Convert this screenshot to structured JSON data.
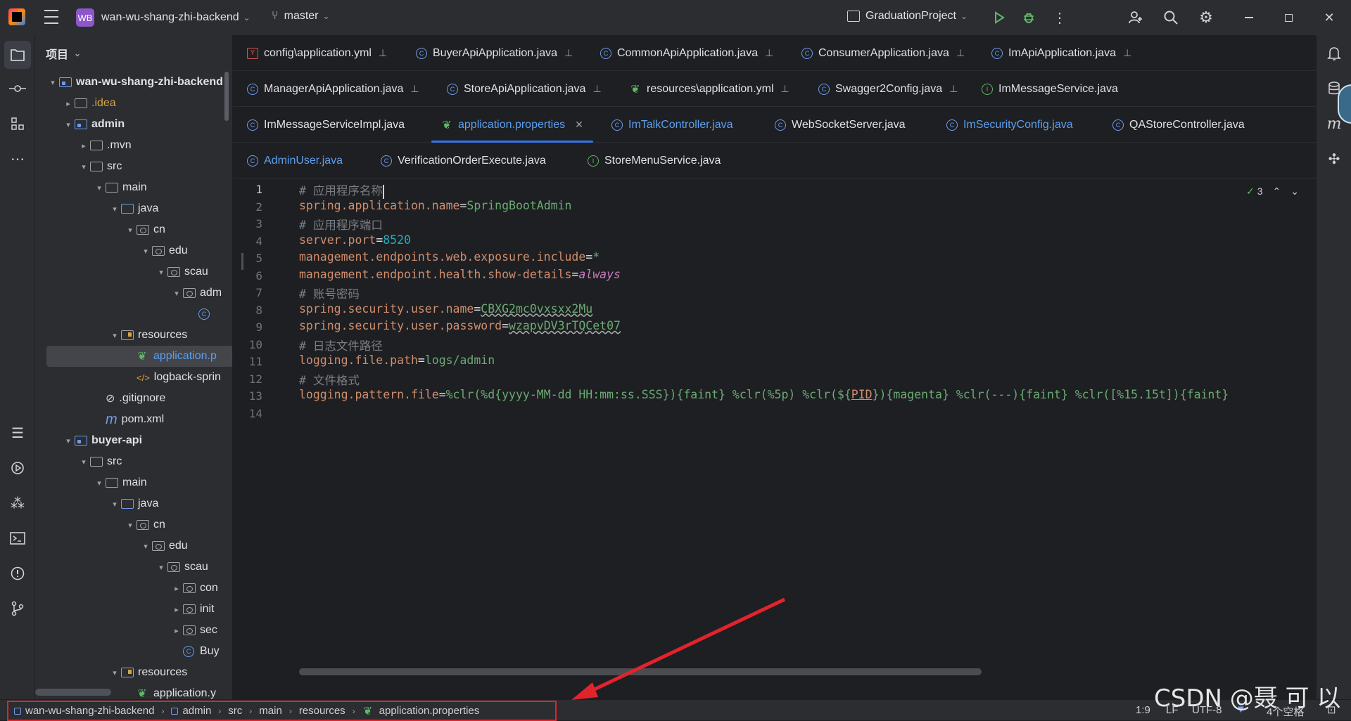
{
  "titlebar": {
    "project_badge": "WB",
    "project_name": "wan-wu-shang-zhi-backend",
    "branch": "master",
    "run_config": "GraduationProject"
  },
  "project_panel": {
    "title": "项目",
    "tree": [
      {
        "label": "wan-wu-shang-zhi-backend",
        "bold": true
      },
      {
        "label": ".idea"
      },
      {
        "label": "admin",
        "bold": true
      },
      {
        "label": ".mvn"
      },
      {
        "label": "src"
      },
      {
        "label": "main"
      },
      {
        "label": "java"
      },
      {
        "label": "cn"
      },
      {
        "label": "edu"
      },
      {
        "label": "scau"
      },
      {
        "label": "adm"
      },
      {
        "label": ""
      },
      {
        "label": "resources"
      },
      {
        "label": "application.p"
      },
      {
        "label": "logback-sprin"
      },
      {
        "label": ".gitignore"
      },
      {
        "label": "pom.xml"
      },
      {
        "label": "buyer-api",
        "bold": true
      },
      {
        "label": "src"
      },
      {
        "label": "main"
      },
      {
        "label": "java"
      },
      {
        "label": "cn"
      },
      {
        "label": "edu"
      },
      {
        "label": "scau"
      },
      {
        "label": "con"
      },
      {
        "label": "init"
      },
      {
        "label": "sec"
      },
      {
        "label": "Buy"
      },
      {
        "label": "resources"
      },
      {
        "label": "application.y"
      }
    ]
  },
  "tabs": {
    "row1": [
      "config\\application.yml",
      "BuyerApiApplication.java",
      "CommonApiApplication.java",
      "ConsumerApplication.java",
      "ImApiApplication.java"
    ],
    "row2": [
      "ManagerApiApplication.java",
      "StoreApiApplication.java",
      "resources\\application.yml",
      "Swagger2Config.java",
      "ImMessageService.java"
    ],
    "row3": [
      "ImMessageServiceImpl.java",
      "application.properties",
      "ImTalkController.java",
      "WebSocketServer.java",
      "ImSecurityConfig.java",
      "QAStoreController.java"
    ],
    "row4": [
      "AdminUser.java",
      "VerificationOrderExecute.java",
      "StoreMenuService.java"
    ]
  },
  "editor": {
    "inspection_count": "3",
    "lines": [
      {
        "n": "1",
        "comment": "# 应用程序名称"
      },
      {
        "n": "2",
        "key": "spring.application.name",
        "value": "SpringBootAdmin"
      },
      {
        "n": "3",
        "comment": "# 应用程序端口"
      },
      {
        "n": "4",
        "key": "server.port",
        "value": "8520"
      },
      {
        "n": "5",
        "key": "management.endpoints.web.exposure.include",
        "value": "*"
      },
      {
        "n": "6",
        "key": "management.endpoint.health.show-details",
        "value": "always"
      },
      {
        "n": "7",
        "comment": "# 账号密码"
      },
      {
        "n": "8",
        "key": "spring.security.user.name",
        "value": "CBXG2mc0vxsxx2Mu"
      },
      {
        "n": "9",
        "key": "spring.security.user.password",
        "value": "wzapvDV3rTQCet07"
      },
      {
        "n": "10",
        "comment": "# 日志文件路径"
      },
      {
        "n": "11",
        "key": "logging.file.path",
        "value": "logs/admin"
      },
      {
        "n": "12",
        "comment": "# 文件格式"
      },
      {
        "n": "13",
        "key": "logging.pattern.file",
        "value_a": "%clr(%d{yyyy-MM-dd HH:mm:ss.SSS}){faint} %clr(%5p) %clr(${",
        "value_pid": "PID",
        "value_b": "}){magenta} %clr(---){faint} %clr([%15.15t]){faint}"
      },
      {
        "n": "14"
      }
    ]
  },
  "statusbar": {
    "breadcrumbs": [
      "wan-wu-shang-zhi-backend",
      "admin",
      "src",
      "main",
      "resources",
      "application.properties"
    ],
    "position": "1:9",
    "line_sep": "LF",
    "encoding": "UTF-8",
    "indent": "4个空格"
  },
  "watermark": "CSDN @聂 可 以",
  "colors": {
    "accent": "#3574f0",
    "annotation": "#e3232c"
  }
}
